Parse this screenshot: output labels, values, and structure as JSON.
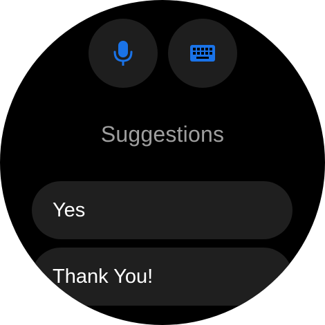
{
  "input_buttons": {
    "voice_icon": "mic-icon",
    "keyboard_icon": "keyboard-icon"
  },
  "colors": {
    "accent": "#1a73e8",
    "background": "#000000",
    "chip_background": "#1f1f1f",
    "title_color": "#9e9e9e"
  },
  "suggestions": {
    "title": "Suggestions",
    "items": [
      {
        "label": "Yes"
      },
      {
        "label": "Thank You!"
      }
    ]
  }
}
